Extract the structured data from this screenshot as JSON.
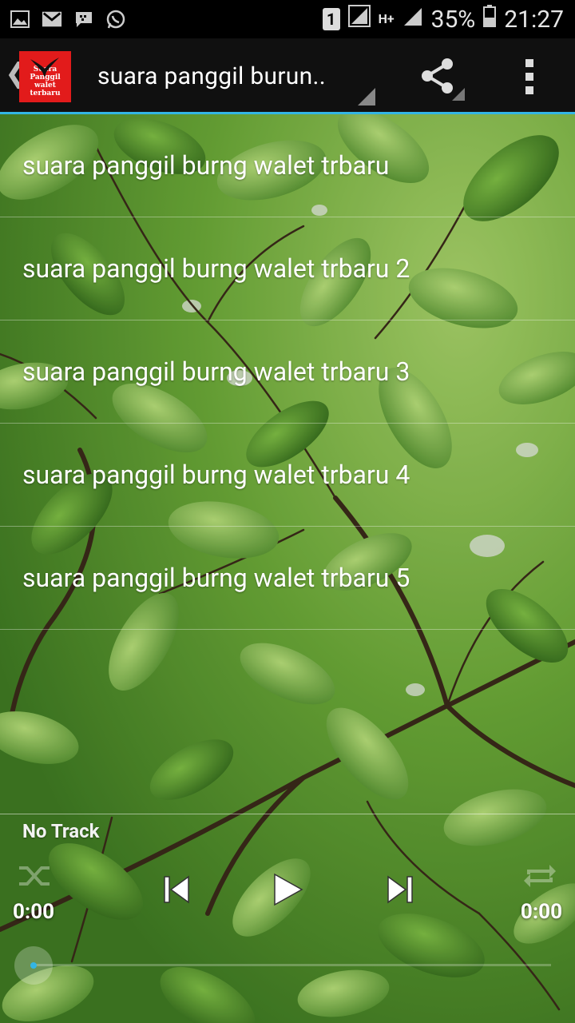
{
  "status_bar": {
    "battery": "35%",
    "time": "21:27",
    "sim": "1",
    "network": "H+"
  },
  "action_bar": {
    "logo_line1": "Suara Panggil",
    "logo_line2": "walet terbaru",
    "title": "suara panggil burun.."
  },
  "tracks": [
    "suara panggil burng walet trbaru",
    "suara panggil burng walet trbaru 2",
    "suara panggil burng walet trbaru 3",
    "suara panggil burng walet trbaru 4",
    "suara panggil burng walet trbaru 5"
  ],
  "player": {
    "now_playing": "No Track",
    "elapsed": "0:00",
    "duration": "0:00",
    "progress": 0
  },
  "colors": {
    "accent": "#33b5e5",
    "logo_red": "#e21b1b"
  }
}
